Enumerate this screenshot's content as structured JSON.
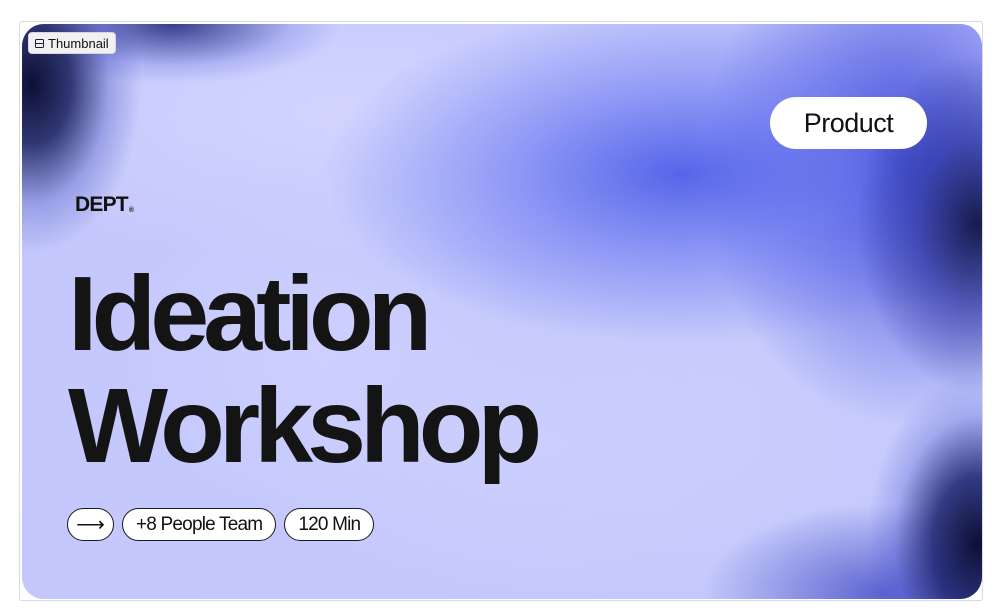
{
  "thumbnail_label": "Thumbnail",
  "slide": {
    "tag": "Product",
    "brand": "DEPT",
    "brand_mark": "®",
    "title_line1": "Ideation",
    "title_line2": "Workshop",
    "arrow": "⟶",
    "meta": [
      "+8 People Team",
      "120 Min"
    ]
  },
  "colors": {
    "background_light": "#c5c9fc",
    "gradient_blue": "#5060e8",
    "gradient_dark": "#0c1036",
    "text": "#111111",
    "pill_background": "#ffffff"
  }
}
